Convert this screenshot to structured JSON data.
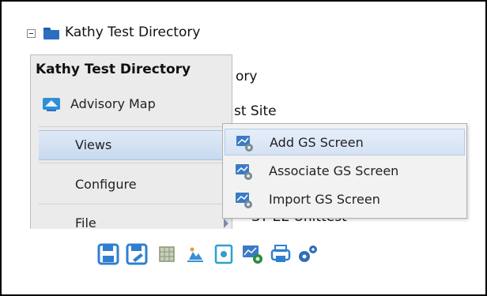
{
  "tree": {
    "root_label": "Kathy Test Directory",
    "partial_rows": [
      "ory",
      "st Site",
      "ST EE Unittest"
    ]
  },
  "context_menu": {
    "header": "Kathy Test Directory",
    "items": [
      {
        "label": "Advisory Map",
        "icon": "map-icon"
      },
      {
        "label": "Views",
        "icon": "",
        "submenu": true,
        "selected": true
      },
      {
        "label": "Configure",
        "icon": "",
        "submenu": true
      },
      {
        "label": "File",
        "icon": "",
        "submenu": true
      }
    ]
  },
  "submenu": {
    "items": [
      {
        "label": "Add GS Screen",
        "icon": "gs-screen-icon"
      },
      {
        "label": "Associate GS Screen",
        "icon": "gs-screen-icon"
      },
      {
        "label": "Import GS Screen",
        "icon": "gs-screen-icon"
      }
    ]
  },
  "toolbar": {
    "buttons": [
      "save-icon",
      "save-as-icon",
      "grid-icon",
      "chart-icon",
      "document-icon",
      "screens-icon",
      "print-icon",
      "settings-icon"
    ]
  },
  "colors": {
    "accent": "#2a6fc0",
    "menu_bg": "#ebebeb",
    "submenu_bg": "#f2f2f2",
    "selection": "#c8daf0"
  }
}
